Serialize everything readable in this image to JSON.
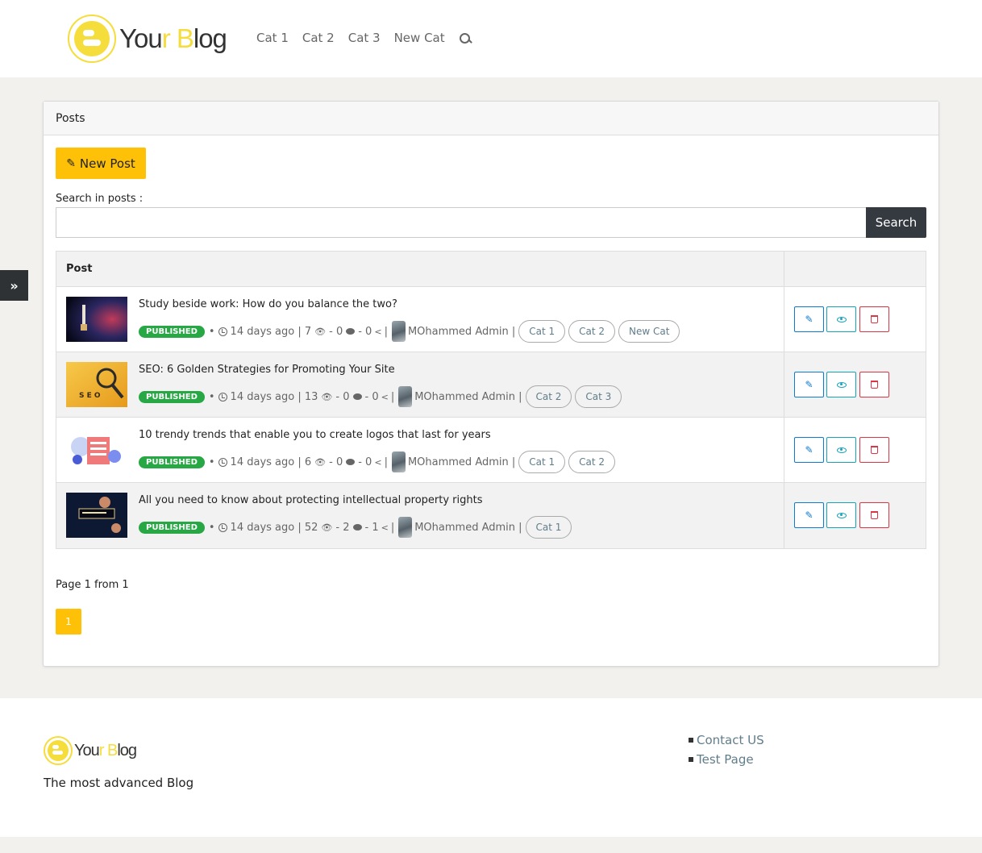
{
  "header": {
    "logo": {
      "part1": "You",
      "part2": "r ",
      "part3": "B",
      "part4": "log"
    },
    "nav": [
      "Cat 1",
      "Cat 2",
      "Cat 3",
      "New Cat"
    ],
    "search_icon": "search-icon"
  },
  "sidebar_toggle": {
    "icon": "double-chevron-right-icon",
    "glyph": "»"
  },
  "card": {
    "title": "Posts",
    "new_post_label": "New Post",
    "search_label": "Search in posts :",
    "search_value": "",
    "search_button": "Search",
    "table": {
      "header_post": "Post",
      "header_actions": ""
    },
    "posts": [
      {
        "title": "Study beside work: How do you balance the two?",
        "status": "PUBLISHED",
        "time": "14 days ago |",
        "views": "7",
        "comments": "- 0",
        "shares": "- 0",
        "author": "MOhammed Admin |",
        "tags": [
          "Cat 1",
          "Cat 2",
          "New Cat"
        ]
      },
      {
        "title": "SEO: 6 Golden Strategies for Promoting Your Site",
        "status": "PUBLISHED",
        "time": "14 days ago |",
        "views": "13",
        "comments": "- 0",
        "shares": "- 0",
        "author": "MOhammed Admin |",
        "tags": [
          "Cat 2",
          "Cat 3"
        ]
      },
      {
        "title": "10 trendy trends that enable you to create logos that last for years",
        "status": "PUBLISHED",
        "time": "14 days ago |",
        "views": "6",
        "comments": "- 0",
        "shares": "- 0",
        "author": "MOhammed Admin |",
        "tags": [
          "Cat 1",
          "Cat 2"
        ]
      },
      {
        "title": "All you need to know about protecting intellectual property rights",
        "status": "PUBLISHED",
        "time": "14 days ago |",
        "views": "52",
        "comments": "- 2",
        "shares": "- 1",
        "author": "MOhammed Admin |",
        "tags": [
          "Cat 1"
        ]
      }
    ],
    "pagination": {
      "info": "Page 1 from 1",
      "current": "1"
    }
  },
  "footer": {
    "tagline": "The most advanced Blog",
    "links": [
      "Contact US",
      "Test Page"
    ]
  },
  "colors": {
    "accent": "#ffc107",
    "logo_yellow": "#f5dd3b",
    "published": "#28a745",
    "edit": "#0e7ad1",
    "view": "#17a2b8",
    "delete": "#dc3545",
    "dark": "#343a40"
  }
}
